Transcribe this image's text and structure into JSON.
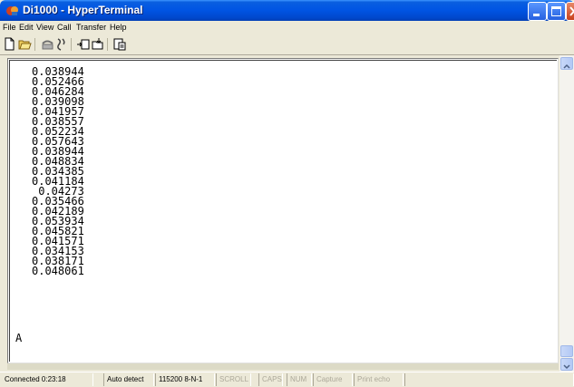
{
  "window": {
    "title": "Di1000 - HyperTerminal",
    "titlebar_color": "#0054e3",
    "icon": "hyperterminal-icon"
  },
  "menu": {
    "items": [
      {
        "label": "File"
      },
      {
        "label": "Edit"
      },
      {
        "label": "View"
      },
      {
        "label": "Call"
      },
      {
        "label": "Transfer"
      },
      {
        "label": "Help"
      }
    ]
  },
  "toolbar": {
    "buttons": [
      {
        "icon": "new-document-icon"
      },
      {
        "icon": "open-folder-icon"
      },
      {
        "icon": "phone-call-icon"
      },
      {
        "icon": "disconnect-icon"
      },
      {
        "icon": "send-file-icon"
      },
      {
        "icon": "receive-file-icon"
      },
      {
        "icon": "properties-icon"
      }
    ]
  },
  "terminal": {
    "lines": [
      "0.038944",
      "0.052466",
      "0.046284",
      "0.039098",
      "0.041957",
      "0.038557",
      "0.052234",
      "0.057643",
      "0.038944",
      "0.048834",
      "0.034385",
      "0.041184",
      " 0.04273",
      "0.035466",
      "0.042189",
      "0.053934",
      "0.045821",
      "0.041571",
      "0.034153",
      "0.038171",
      "0.048061"
    ],
    "prompt": "A"
  },
  "status": {
    "connected": "Connected 0:23:18",
    "detect": "Auto detect",
    "settings": "115200 8-N-1",
    "scroll": "SCROLL",
    "caps": "CAPS",
    "num": "NUM",
    "capture": "Capture",
    "print_echo": "Print echo"
  }
}
